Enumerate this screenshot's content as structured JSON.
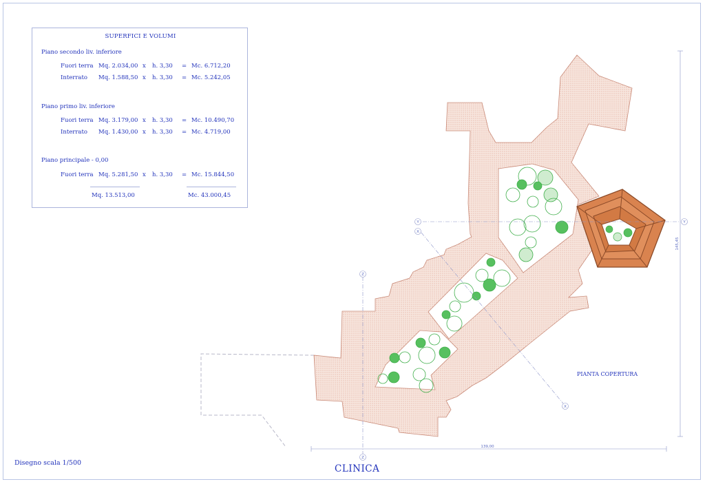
{
  "table": {
    "title": "SUPERFICI E VOLUMI",
    "sections": [
      {
        "heading": "Piano secondo liv. inferiore",
        "rows": [
          {
            "label": "Fuori terra",
            "area": "Mq. 2.034,00",
            "times": "x",
            "height": "h. 3,30",
            "eq": "=",
            "volume": "Mc. 6.712,20"
          },
          {
            "label": "Interrato",
            "area": "Mq. 1.588,50",
            "times": "x",
            "height": "h. 3,30",
            "eq": "=",
            "volume": "Mc. 5.242,05"
          }
        ]
      },
      {
        "heading": "Piano primo liv. inferiore",
        "rows": [
          {
            "label": "Fuori terra",
            "area": "Mq. 3.179,00",
            "times": "x",
            "height": "h. 3,30",
            "eq": "=",
            "volume": "Mc. 10.490,70"
          },
          {
            "label": "Interrato",
            "area": "Mq. 1.430,00",
            "times": "x",
            "height": "h. 3,30",
            "eq": "=",
            "volume": "Mc. 4.719,00"
          }
        ]
      },
      {
        "heading": "Piano principale - 0,00",
        "rows": [
          {
            "label": "Fuori terra",
            "area": "Mq. 5.281,50",
            "times": "x",
            "height": "h. 3,30",
            "eq": "=",
            "volume": "Mc. 15.844,50"
          }
        ]
      }
    ],
    "totals": {
      "area": "Mq. 13.513,00",
      "volume": "Mc. 43.000,45"
    }
  },
  "drawing": {
    "plan_label": "PIANTA COPERTURA",
    "axis_markers": {
      "y": "Y",
      "x": "X",
      "z": "Z"
    },
    "dim_horizontal": "139,00",
    "dim_vertical": "145,45",
    "colors": {
      "roof_fill": "#f6e3da",
      "hatch": "#e6b8a6",
      "outline": "#c07a66",
      "dome": "#d9834f",
      "dome_edge": "#8b4a28",
      "tree": "#3fae4a",
      "ink": "#2233bb"
    }
  },
  "footer": {
    "scale_note": "Disegno scala 1/500",
    "title": "CLINICA"
  }
}
